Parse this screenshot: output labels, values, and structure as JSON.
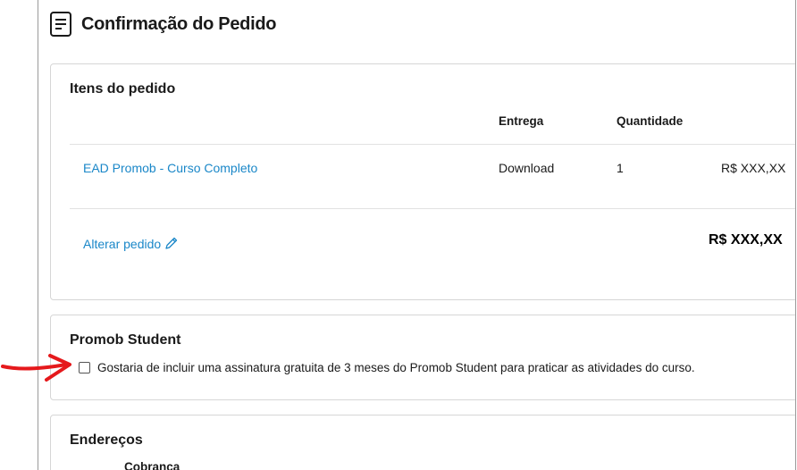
{
  "page": {
    "title": "Confirmação do Pedido",
    "icon": "document-icon"
  },
  "order_items": {
    "title": "Itens do pedido",
    "columns": {
      "delivery": "Entrega",
      "quantity": "Quantidade"
    },
    "rows": [
      {
        "product": "EAD Promob - Curso Completo",
        "delivery": "Download",
        "quantity": "1",
        "price": "R$ XXX,XX"
      }
    ],
    "edit_label": "Alterar pedido",
    "edit_icon": "pencil-icon",
    "total": "R$ XXX,XX"
  },
  "student": {
    "title": "Promob Student",
    "checkbox_label": "Gostaria de incluir uma assinatura gratuita de 3 meses do Promob Student para praticar as atividades do curso.",
    "checked": false
  },
  "addresses": {
    "title": "Endereços",
    "sub_heading": "Cobrança"
  },
  "annotation": {
    "arrow_color": "#e5191c"
  }
}
